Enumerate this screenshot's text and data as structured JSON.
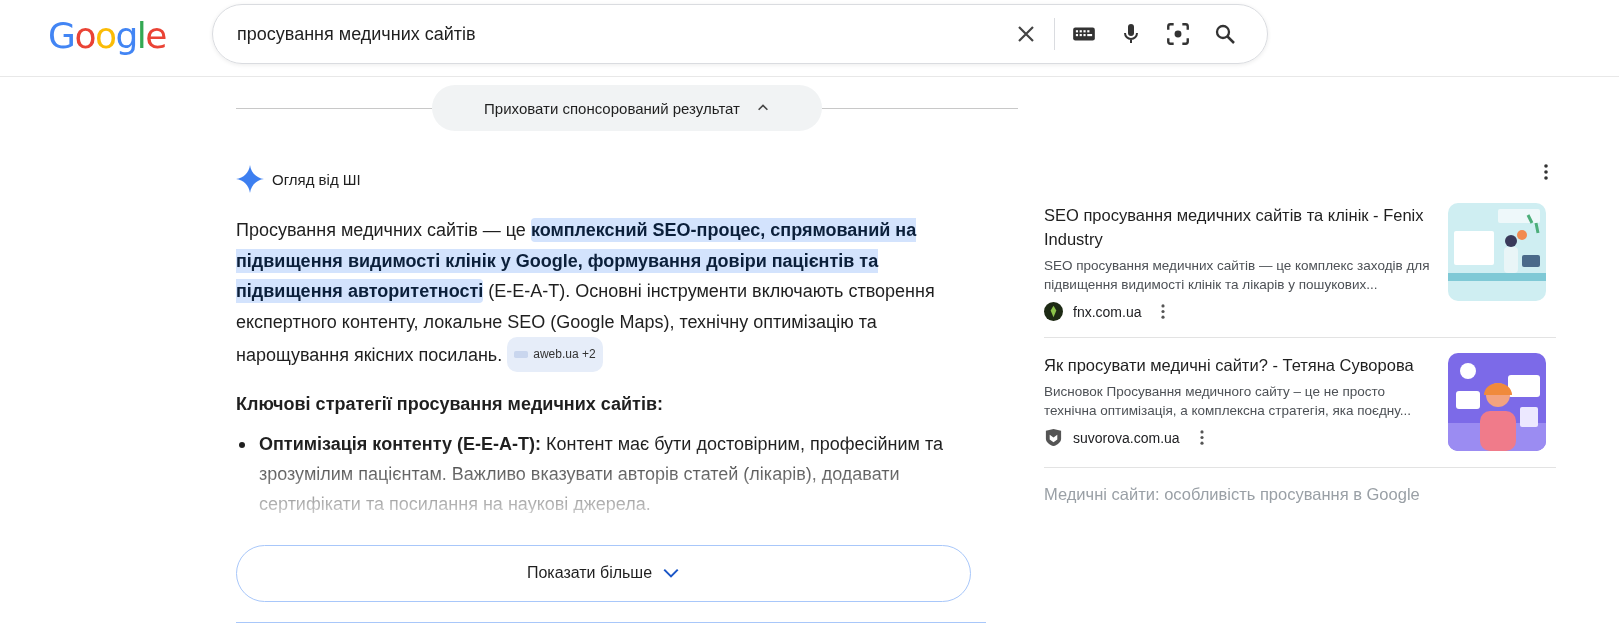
{
  "logo": "Google",
  "search": {
    "value": "просування медичних сайтів"
  },
  "sponsored_toggle": {
    "label": "Приховати спонсорований результат",
    "expanded": true
  },
  "ai_overview": {
    "title": "Огляд від ШІ",
    "summary": {
      "before": "Просування медичних сайтів — це ",
      "highlighted": "комплексний SEO-процес, спрямований на підвищення видимості клінік у Google, формування довіри пацієнтів та підвищення авторитетності",
      "after": " (E-E-A-T). Основні інструменти включають створення експертного контенту, локальне SEO (Google Maps), технічну оптимізацію та нарощування якісних посилань.",
      "citation": "aweb.ua +2"
    },
    "heading": "Ключові стратегії просування медичних сайтів:",
    "bullets": [
      {
        "label": "Оптимізація контенту (E-E-A-T):",
        "text": "Контент має бути достовірним, професійним та зрозумілим пацієнтам. Важливо вказувати авторів статей (лікарів), додавати сертифікати та посилання на наукові джерела."
      }
    ],
    "show_more": "Показати більше"
  },
  "sources": [
    {
      "title": "SEO просування медичних сайтів та клінік - Fenix Industry",
      "snippet": "SEO просування медичних сайтів — це комплекс заходів для підвищення видимості клінік та лікарів у пошукових...",
      "site": "fnx.com.ua",
      "faded": false,
      "kind": "picture"
    },
    {
      "title": "Як просувати медичні сайти? - Тетяна Суворова",
      "snippet": "Висновок Просування медичного сайту – це не просто технічна оптимізація, а комплексна стратегія, яка поєдну...",
      "site": "suvorova.com.ua",
      "faded": false,
      "kind": "picture"
    },
    {
      "title": "Медичні сайти: особливість просування в Google",
      "faded": true
    }
  ]
}
